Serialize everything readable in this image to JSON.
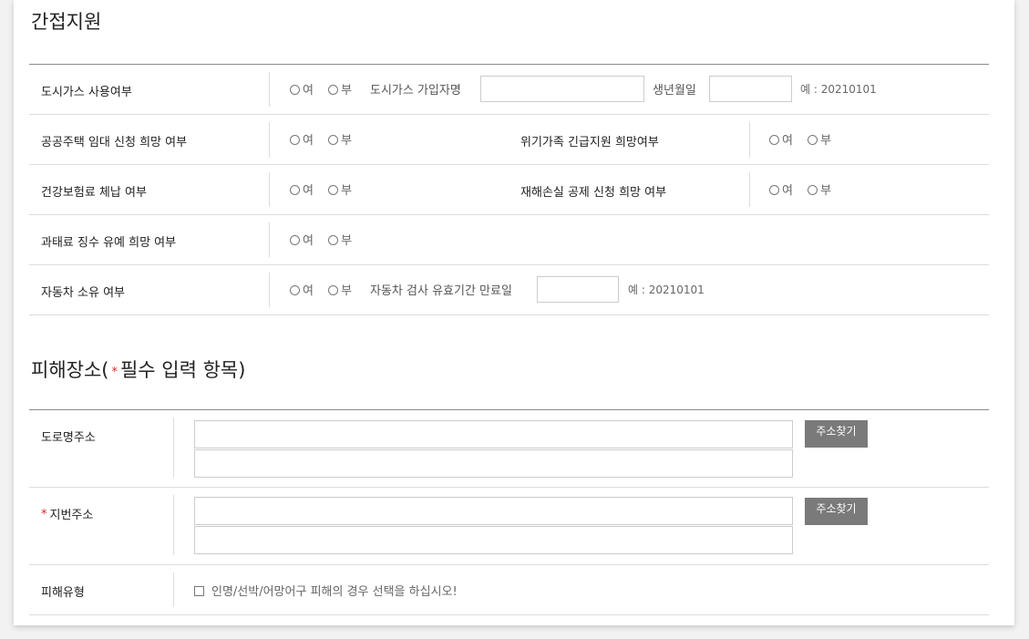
{
  "section1": {
    "title": "간접지원",
    "rows": [
      {
        "label": "도시가스 사용여부",
        "yes": "여",
        "no": "부",
        "sub_label": "도시가스 가입자명",
        "sub_label2": "생년월일",
        "hint": "예 : 20210101"
      },
      {
        "label": "공공주택 임대 신청 희망 여부",
        "yes": "여",
        "no": "부",
        "right_label": "위기가족 긴급지원 희망여부",
        "right_yes": "여",
        "right_no": "부"
      },
      {
        "label": "건강보험료 체납 여부",
        "yes": "여",
        "no": "부",
        "right_label": "재해손실 공제 신청 희망 여부",
        "right_yes": "여",
        "right_no": "부"
      },
      {
        "label": "과태료 징수 유예 희망 여부",
        "yes": "여",
        "no": "부"
      },
      {
        "label": "자동차 소유 여부",
        "yes": "여",
        "no": "부",
        "sub_label": "자동차 검사 유효기간 만료일",
        "hint": "예 : 20210101"
      }
    ]
  },
  "section2": {
    "title_prefix": "피해장소(",
    "required_mark": "*",
    "title_suffix": "필수 입력 항목)",
    "road_label": "도로명주소",
    "jibun_label": "지번주소",
    "find_button": "주소찾기",
    "type_label": "피해유형",
    "type_checkbox_text": "인명/선박/어망어구 피해의 경우 선택을 하십시오!"
  }
}
